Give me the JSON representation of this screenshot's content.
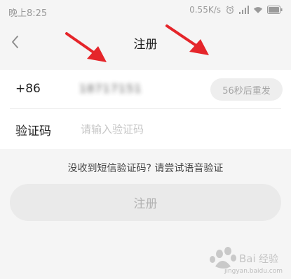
{
  "status_bar": {
    "time": "晚上8:25",
    "network_speed": "0.55K/s",
    "icons": [
      "alarm-icon",
      "signal-icon",
      "wifi-icon",
      "battery-icon"
    ]
  },
  "header": {
    "title": "注册",
    "back_icon": "chevron-left-icon"
  },
  "form": {
    "country_code": "+86",
    "phone_number_masked": "18717151",
    "resend_label": "56秒后重发",
    "code_label": "验证码",
    "code_placeholder": "请输入验证码",
    "code_value": ""
  },
  "voice_verification_link": "没收到短信验证码? 请尝试语音验证",
  "register_button": "注册",
  "watermark": {
    "text": "Baidu经验",
    "url": "jingyan.baidu.com"
  },
  "colors": {
    "background": "#f5f5f5",
    "card": "#ffffff",
    "disabled_button": "#eaeaea",
    "annotation_arrow": "#e5252a"
  }
}
